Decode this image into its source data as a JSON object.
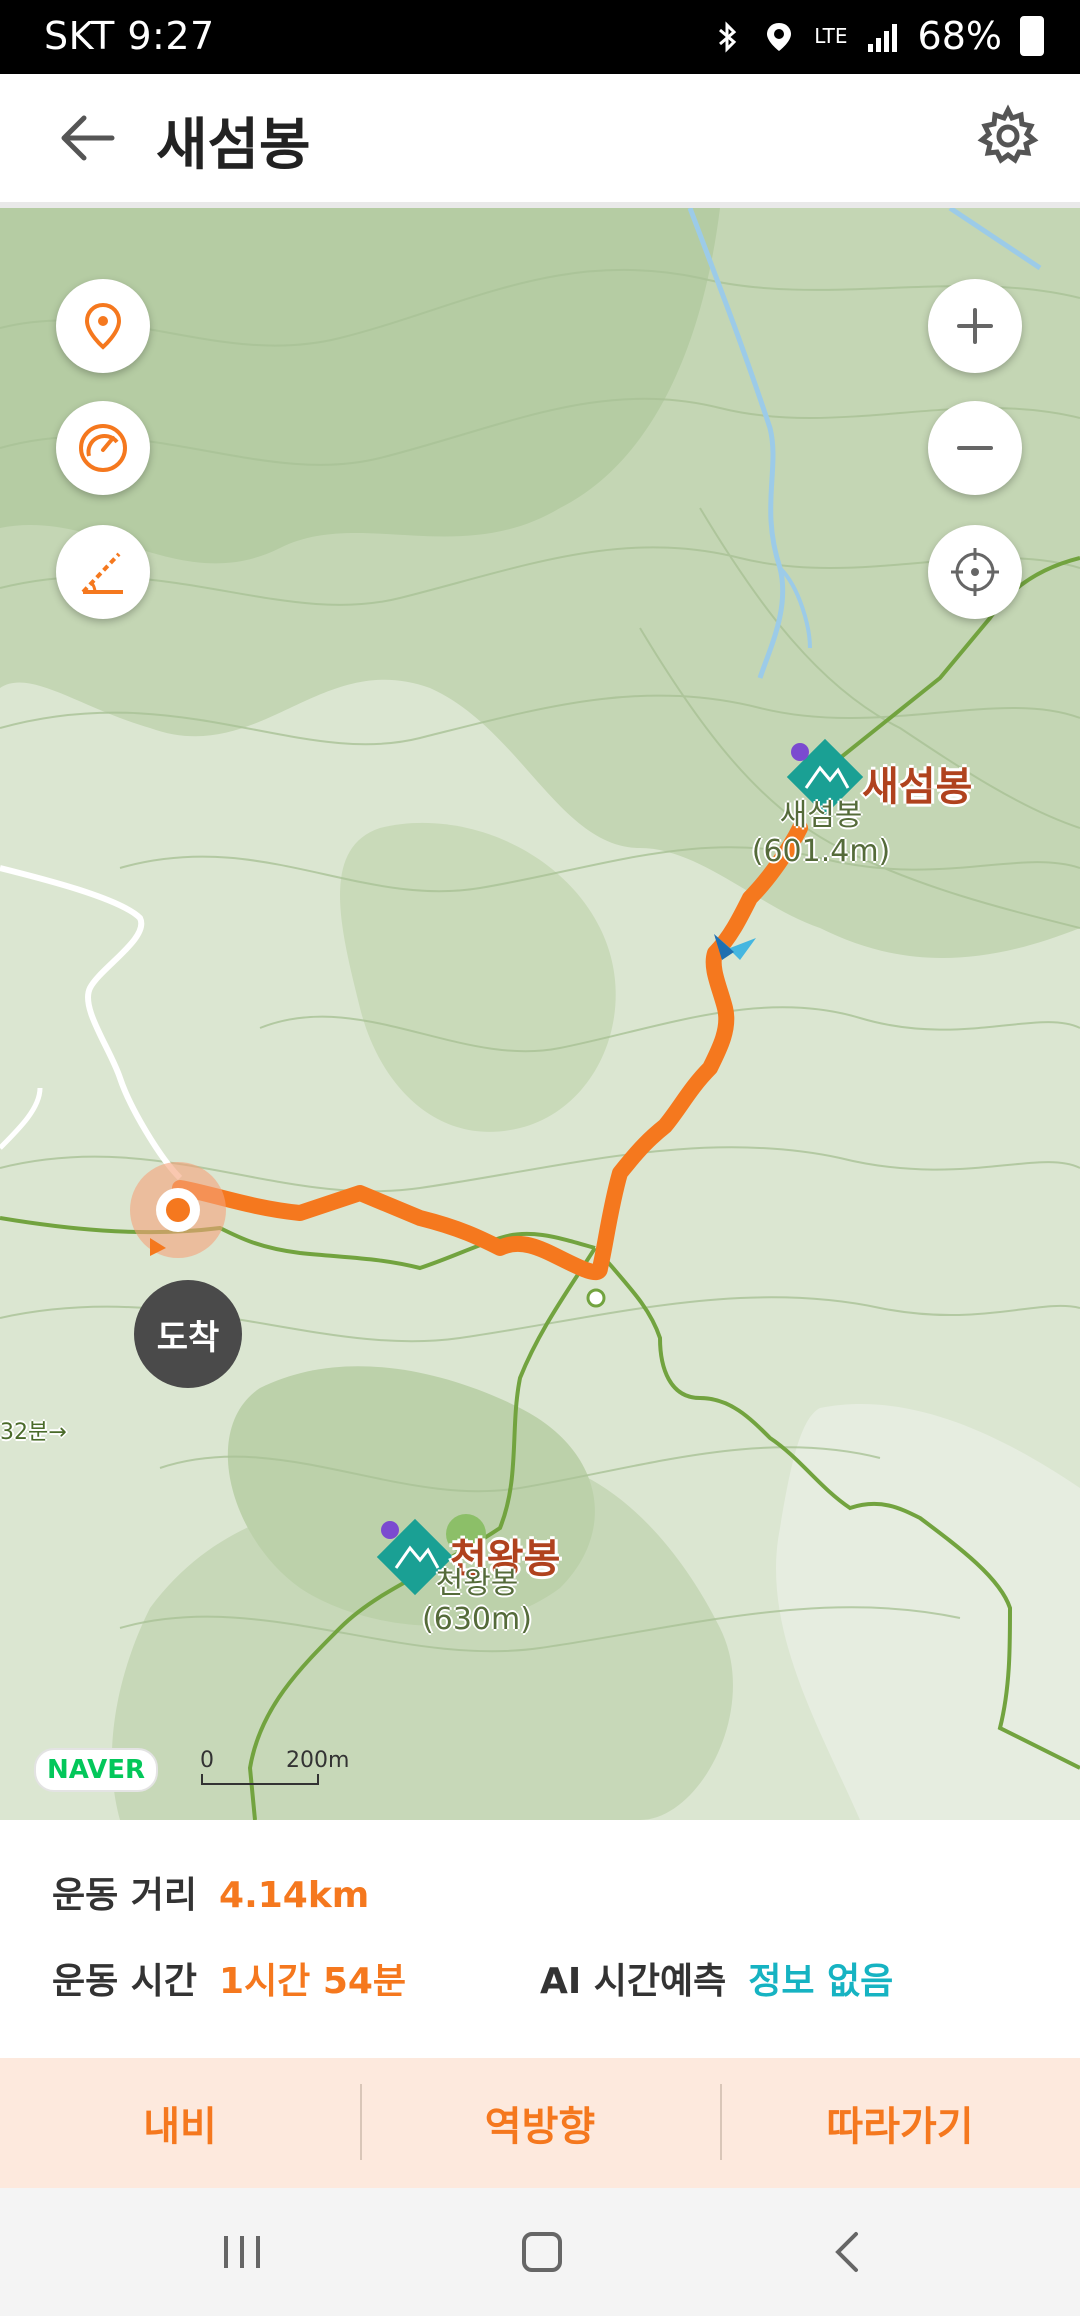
{
  "status_bar": {
    "carrier_time": "SKT 9:27",
    "network": "LTE",
    "battery": "68%",
    "icons": [
      "bluetooth-icon",
      "location-icon",
      "signal-icon",
      "battery-icon"
    ]
  },
  "app_bar": {
    "title": "새섬봉",
    "back_icon": "arrow-left-icon",
    "settings_icon": "gear-icon"
  },
  "map": {
    "left_controls": [
      "location-pin-icon",
      "speedometer-icon",
      "slope-icon"
    ],
    "right_controls": [
      "zoom-in-icon",
      "zoom-out-icon",
      "crosshair-icon"
    ],
    "arrive_label": "도착",
    "trail_time_label": "32분→",
    "peaks": [
      {
        "label": "새섬봉",
        "sub1": "새섬봉",
        "sub2": "(601.4m)"
      },
      {
        "label": "천왕봉",
        "sub1": "천왕봉",
        "sub2": "(630m)"
      }
    ],
    "logo": "NAVER",
    "scale_zero": "0",
    "scale_value": "200m",
    "colors": {
      "route": "#f5781e",
      "trail": "#72a33f",
      "water": "#9ccbe8"
    }
  },
  "stats": {
    "distance_label": "운동 거리",
    "distance_value": "4.14km",
    "time_label": "운동 시간",
    "time_value": "1시간 54분",
    "ai_label": "AI 시간예측",
    "ai_value": "정보 없음"
  },
  "actions": {
    "navi": "내비",
    "reverse": "역방향",
    "follow": "따라가기"
  },
  "nav": [
    "recent-apps-icon",
    "home-icon",
    "back-icon"
  ]
}
